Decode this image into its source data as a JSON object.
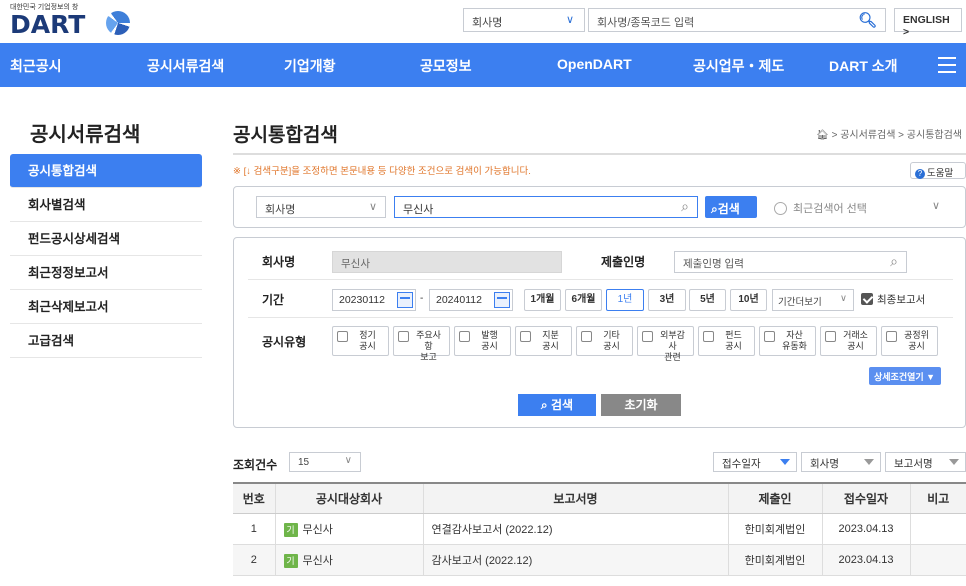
{
  "header": {
    "logo_sub": "대한민국 기업정보의 창",
    "logo_text": "DART",
    "company_select": "회사명",
    "search_placeholder": "회사명/종목코드 입력",
    "english_label": "ENGLISH >"
  },
  "nav": {
    "items": [
      "최근공시",
      "공시서류검색",
      "기업개황",
      "공모정보",
      "OpenDART",
      "공시업무・제도",
      "DART 소개"
    ]
  },
  "sidebar": {
    "title": "공시서류검색",
    "items": [
      "공시통합검색",
      "회사별검색",
      "펀드공시상세검색",
      "최근정정보고서",
      "최근삭제보고서",
      "고급검색"
    ]
  },
  "main": {
    "title": "공시통합검색",
    "breadcrumb": "공시서류검색 > 공시통합검색",
    "notice": "※ [↓ 검색구분]을 조정하면 본문내용 등 다양한 조건으로 검색이 가능합니다.",
    "help_label": "도움말"
  },
  "searchbar": {
    "type_value": "회사명",
    "query_value": "무신사",
    "search_label": "검색",
    "recent_placeholder": "최근검색어 선택"
  },
  "filter": {
    "company_label": "회사명",
    "company_value": "무신사",
    "submitter_label": "제출인명",
    "submitter_placeholder": "제출인명 입력",
    "period_label": "기간",
    "date_from": "20230112",
    "date_sep": "-",
    "date_to": "20240112",
    "period_buttons": [
      "1개월",
      "6개월",
      "1년",
      "3년",
      "5년",
      "10년"
    ],
    "period_active": "1년",
    "period_select": "기간더보기",
    "final_report_label": "최종보고서",
    "final_report_checked": true,
    "type_label": "공시유형",
    "types": [
      [
        "정기",
        "공시"
      ],
      [
        "주요사항",
        "보고"
      ],
      [
        "발행",
        "공시"
      ],
      [
        "지분",
        "공시"
      ],
      [
        "기타",
        "공시"
      ],
      [
        "외부감사",
        "관련"
      ],
      [
        "펀드",
        "공시"
      ],
      [
        "자산",
        "유동화"
      ],
      [
        "거래소",
        "공시"
      ],
      [
        "공정위",
        "공시"
      ]
    ],
    "detail_toggle": "상세조건열기 ▼",
    "search_button": "검색",
    "reset_button": "초기화"
  },
  "results": {
    "count_label": "조회건수",
    "count_value": "15",
    "sort_options": [
      "접수일자",
      "회사명",
      "보고서명"
    ],
    "columns": [
      "번호",
      "공시대상회사",
      "보고서명",
      "제출인",
      "접수일자",
      "비고"
    ],
    "rows": [
      {
        "no": "1",
        "badge": "기",
        "company": "무신사",
        "report": "연결감사보고서 (2022.12)",
        "submitter": "한미회계법인",
        "date": "2023.04.13",
        "note": ""
      },
      {
        "no": "2",
        "badge": "기",
        "company": "무신사",
        "report": "감사보고서 (2022.12)",
        "submitter": "한미회계법인",
        "date": "2023.04.13",
        "note": ""
      }
    ]
  },
  "colors": {
    "brand_blue": "#3c7ff0",
    "notice_orange": "#e0762b",
    "badge_green": "#6fb54a"
  }
}
